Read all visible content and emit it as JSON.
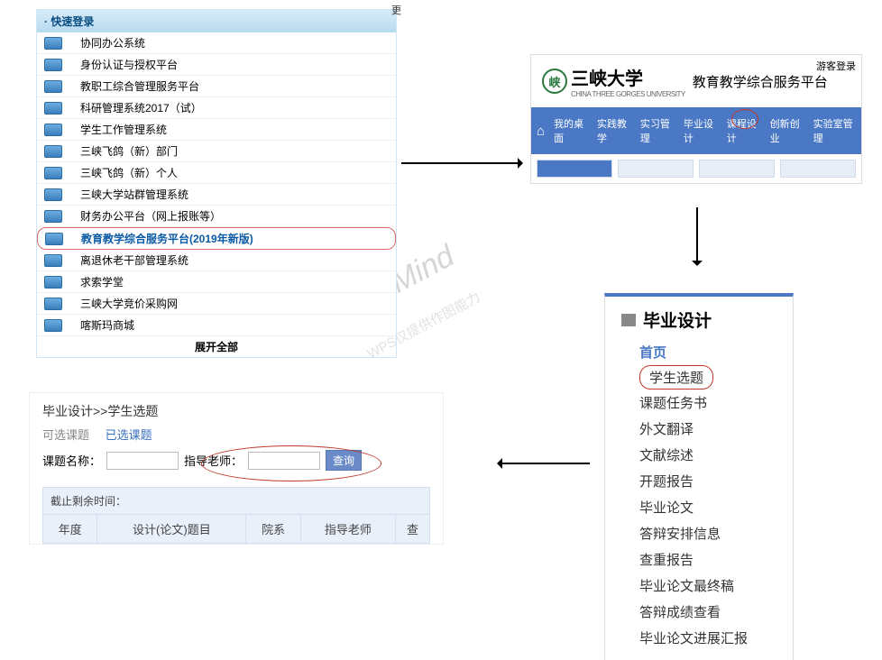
{
  "panel1": {
    "more": "更",
    "header": "· 快速登录",
    "items": [
      {
        "label": "协同办公系统"
      },
      {
        "label": "身份认证与授权平台"
      },
      {
        "label": "教职工综合管理服务平台"
      },
      {
        "label": "科研管理系统2017（试）"
      },
      {
        "label": "学生工作管理系统"
      },
      {
        "label": "三峡飞鸽（新）部门"
      },
      {
        "label": "三峡飞鸽（新）个人"
      },
      {
        "label": "三峡大学站群管理系统"
      },
      {
        "label": "财务办公平台（网上报账等）"
      },
      {
        "label": "教育教学综合服务平台(2019年新版)"
      },
      {
        "label": "离退休老干部管理系统"
      },
      {
        "label": "求索学堂"
      },
      {
        "label": "三峡大学竞价采购网"
      },
      {
        "label": "喀斯玛商城"
      }
    ],
    "footer": "展开全部"
  },
  "panel2": {
    "more_login": "游客登录",
    "uni_name": "三峡大学",
    "uni_sub": "CHINA THREE GORGES UNIVERSITY",
    "portal_title": "教育教学综合服务平台",
    "nav": [
      "我的桌面",
      "实践教学",
      "实习管理",
      "毕业设计",
      "课程设计",
      "创新创业",
      "实验室管理"
    ]
  },
  "panel3": {
    "title": "毕业设计",
    "items": [
      "首页",
      "学生选题",
      "课题任务书",
      "外文翻译",
      "文献综述",
      "开题报告",
      "毕业论文",
      "答辩安排信息",
      "查重报告",
      "毕业论文最终稿",
      "答辩成绩查看",
      "毕业论文进展汇报"
    ]
  },
  "panel4": {
    "breadcrumb": "毕业设计>>学生选题",
    "tabs": {
      "available": "可选课题",
      "selected": "已选课题"
    },
    "form": {
      "topic_label": "课题名称：",
      "advisor_label": "指导老师：",
      "query_btn": "查询"
    },
    "deadline_label": "截止剩余时间：",
    "columns": [
      "年度",
      "设计(论文)题目",
      "院系",
      "指导老师",
      "查"
    ]
  },
  "watermark": {
    "big": "WPS Mind",
    "small": "WPS仅提供作图能力"
  }
}
